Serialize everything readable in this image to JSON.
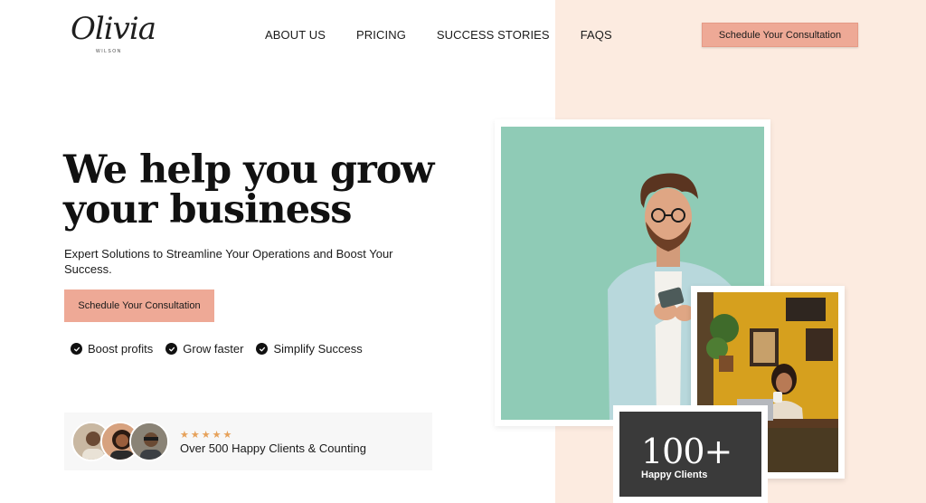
{
  "brand": {
    "logo_script": "Olivia",
    "logo_sub": "WILSON"
  },
  "nav": {
    "items": [
      {
        "label": "ABOUT US"
      },
      {
        "label": "PRICING"
      },
      {
        "label": "SUCCESS STORIES"
      },
      {
        "label": "FAQS"
      }
    ]
  },
  "header": {
    "cta_label": "Schedule Your Consultation"
  },
  "hero": {
    "title_line1": "We help you grow",
    "title_line2": "your business",
    "subtitle": "Expert Solutions to Streamline Your Operations and Boost Your Success.",
    "cta_label": "Schedule Your Consultation",
    "features": [
      {
        "label": "Boost profits"
      },
      {
        "label": "Grow faster"
      },
      {
        "label": "Simplify Success"
      }
    ]
  },
  "social_proof": {
    "stars": "★★★★★",
    "rating": 5,
    "text": "Over 500 Happy Clients & Counting"
  },
  "stat": {
    "number": "100+",
    "label": "Happy Clients"
  },
  "colors": {
    "accent": "#eea996",
    "peach_panel": "#fcebe0",
    "mint_photo_bg": "#8fcbb6",
    "stat_bg": "#3a3a3a",
    "star": "#e6a15a"
  },
  "icons": [
    "check-circle-icon",
    "star-icon"
  ]
}
